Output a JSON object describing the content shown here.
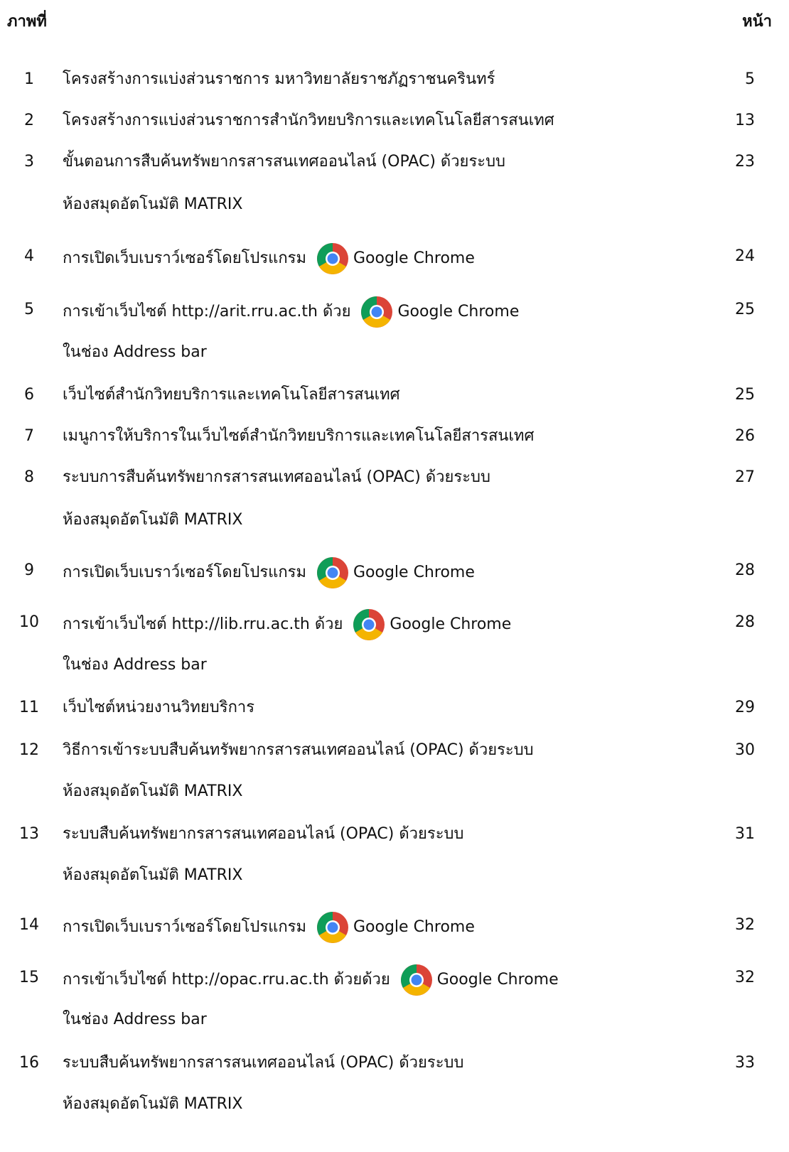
{
  "header": {
    "left": "ภาพที่",
    "right": "หน้า"
  },
  "entries": [
    {
      "num": "1",
      "text": "โครงสร้างการแบ่งส่วนราชการ มหาวิทยาลัยราชภัฏราชนครินทร์",
      "page": "5"
    },
    {
      "num": "2",
      "text": "โครงสร้างการแบ่งส่วนราชการสำนักวิทยบริการและเทคโนโลยีสารสนเทศ",
      "page": "13"
    },
    {
      "num": "3",
      "text": "ขั้นตอนการสืบค้นทรัพยากรสารสนเทศออนไลน์ (OPAC) ด้วยระบบ",
      "cont": "ห้องสมุดอัตโนมัติ MATRIX",
      "page": "23"
    },
    {
      "num": "4",
      "text": "การเปิดเว็บเบราว์เซอร์โดยโปรแกรม",
      "app": "Google Chrome",
      "page": "24"
    },
    {
      "num": "5",
      "text": "การเข้าเว็บไซต์ http://arit.rru.ac.th ด้วย",
      "app": "Google Chrome",
      "cont": "ในช่อง Address bar",
      "page": "25"
    },
    {
      "num": "6",
      "text": "เว็บไซต์สำนักวิทยบริการและเทคโนโลยีสารสนเทศ",
      "page": "25"
    },
    {
      "num": "7",
      "text": "เมนูการให้บริการในเว็บไซต์สำนักวิทยบริการและเทคโนโลยีสารสนเทศ",
      "page": "26"
    },
    {
      "num": "8",
      "text": "ระบบการสืบค้นทรัพยากรสารสนเทศออนไลน์ (OPAC) ด้วยระบบ",
      "cont": "ห้องสมุดอัตโนมัติ MATRIX",
      "page": "27"
    },
    {
      "num": "9",
      "text": "การเปิดเว็บเบราว์เซอร์โดยโปรแกรม",
      "app": "Google Chrome",
      "page": "28"
    },
    {
      "num": "10",
      "text": "การเข้าเว็บไซต์ http://lib.rru.ac.th ด้วย",
      "app": "Google Chrome",
      "cont": "ในช่อง Address bar",
      "page": "28"
    },
    {
      "num": "11",
      "text": "เว็บไซต์หน่วยงานวิทยบริการ",
      "page": "29"
    },
    {
      "num": "12",
      "text": "วิธีการเข้าระบบสืบค้นทรัพยากรสารสนเทศออนไลน์ (OPAC) ด้วยระบบ",
      "cont": "ห้องสมุดอัตโนมัติ MATRIX",
      "page": "30"
    },
    {
      "num": "13",
      "text": "ระบบสืบค้นทรัพยากรสารสนเทศออนไลน์ (OPAC) ด้วยระบบ",
      "cont": "ห้องสมุดอัตโนมัติ MATRIX",
      "page": "31"
    },
    {
      "num": "14",
      "text": "การเปิดเว็บเบราว์เซอร์โดยโปรแกรม",
      "app": "Google Chrome",
      "page": "32"
    },
    {
      "num": "15",
      "text": "การเข้าเว็บไซต์ http://opac.rru.ac.th ด้วยด้วย",
      "app": "Google Chrome",
      "cont": "ในช่อง Address bar",
      "page": "32"
    },
    {
      "num": "16",
      "text": "ระบบสืบค้นทรัพยากรสารสนเทศออนไลน์ (OPAC) ด้วยระบบ",
      "cont": "ห้องสมุดอัตโนมัติ MATRIX",
      "page": "33"
    }
  ],
  "icons": {
    "app_icon": "chrome-icon"
  }
}
